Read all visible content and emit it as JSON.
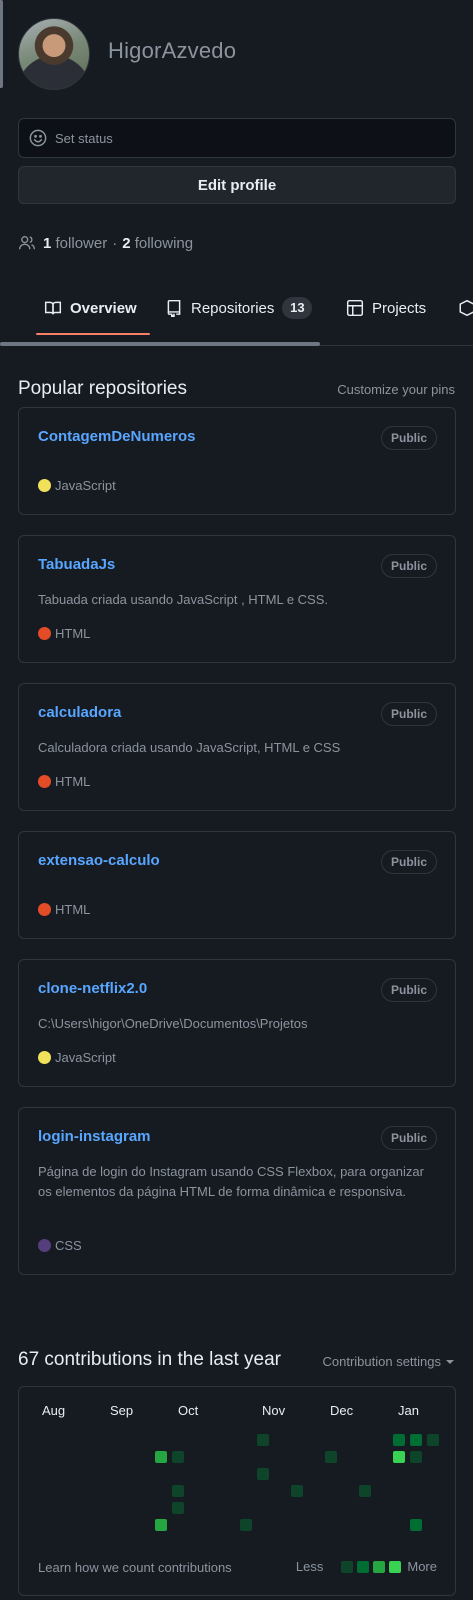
{
  "profile": {
    "username": "HigorAzvedo",
    "set_status": "Set status",
    "edit_profile": "Edit profile",
    "followers_count": "1",
    "followers_label": "follower",
    "separator": "·",
    "following_count": "2",
    "following_label": "following"
  },
  "tabs": [
    {
      "label": "Overview",
      "icon": "book-icon",
      "active": true
    },
    {
      "label": "Repositories",
      "icon": "repo-icon",
      "count": "13"
    },
    {
      "label": "Projects",
      "icon": "table-icon"
    }
  ],
  "popular": {
    "title": "Popular repositories",
    "customize": "Customize your pins",
    "repos": [
      {
        "name": "ContagemDeNumeros",
        "visibility": "Public",
        "description": "",
        "language": "JavaScript",
        "language_color": "#f1e05a"
      },
      {
        "name": "TabuadaJs",
        "visibility": "Public",
        "description": "Tabuada criada usando JavaScript , HTML e CSS.",
        "language": "HTML",
        "language_color": "#e34c26"
      },
      {
        "name": "calculadora",
        "visibility": "Public",
        "description": "Calculadora criada usando JavaScript, HTML e CSS",
        "language": "HTML",
        "language_color": "#e34c26"
      },
      {
        "name": "extensao-calculo",
        "visibility": "Public",
        "description": "",
        "language": "HTML",
        "language_color": "#e34c26"
      },
      {
        "name": "clone-netflix2.0",
        "visibility": "Public",
        "description": "C:\\Users\\higor\\OneDrive\\Documentos\\Projetos",
        "language": "JavaScript",
        "language_color": "#f1e05a"
      },
      {
        "name": "login-instagram",
        "visibility": "Public",
        "description": "Página de login do Instagram usando CSS Flexbox, para organizar os elementos da página HTML de forma dinâmica e responsiva.",
        "language": "CSS",
        "language_color": "#563d7c"
      }
    ]
  },
  "contributions": {
    "title": "67 contributions in the last year",
    "settings": "Contribution settings",
    "months": [
      "Aug",
      "Sep",
      "Oct",
      "Nov",
      "Dec",
      "Jan"
    ],
    "learn": "Learn how we count contributions",
    "less": "Less",
    "more": "More",
    "level_colors": [
      "#0e4429",
      "#006d32",
      "#26a641",
      "#39d353"
    ],
    "cells": [
      {
        "week": 6,
        "day": 2,
        "level": 2
      },
      {
        "week": 7,
        "day": 2,
        "level": 0
      },
      {
        "week": 7,
        "day": 4,
        "level": 0
      },
      {
        "week": 7,
        "day": 5,
        "level": 0
      },
      {
        "week": 6,
        "day": 6,
        "level": 2
      },
      {
        "week": 11,
        "day": 6,
        "level": 0
      },
      {
        "week": 12,
        "day": 1,
        "level": 0
      },
      {
        "week": 12,
        "day": 3,
        "level": 0
      },
      {
        "week": 14,
        "day": 4,
        "level": 0
      },
      {
        "week": 16,
        "day": 2,
        "level": 0
      },
      {
        "week": 18,
        "day": 4,
        "level": 0
      },
      {
        "week": 20,
        "day": 1,
        "level": 1
      },
      {
        "week": 20,
        "day": 2,
        "level": 3
      },
      {
        "week": 21,
        "day": 1,
        "level": 1
      },
      {
        "week": 21,
        "day": 2,
        "level": 0
      },
      {
        "week": 21,
        "day": 6,
        "level": 1
      },
      {
        "week": 22,
        "day": 1,
        "level": 0
      }
    ]
  }
}
